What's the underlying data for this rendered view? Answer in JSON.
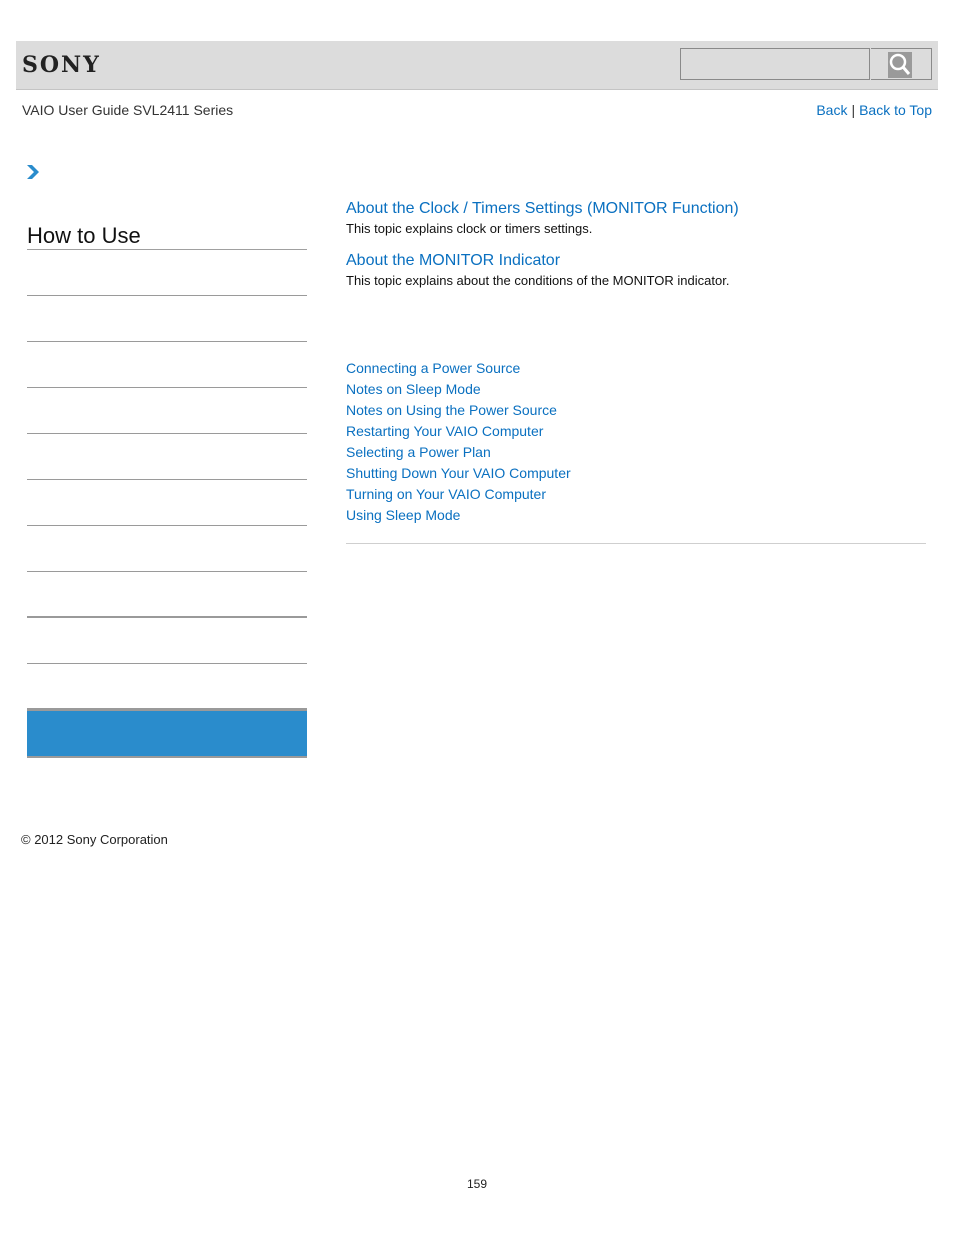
{
  "header": {
    "logo": "SONY",
    "search_placeholder": "",
    "search_icon": "magnifier-icon"
  },
  "guide_title": "VAIO User Guide SVL2411 Series",
  "nav": {
    "back": "Back",
    "separator": "|",
    "back_to_top": "Back to Top"
  },
  "breadcrumb_icon": "chevron-right-icon",
  "sidebar": {
    "title": "How to Use",
    "items": [
      "",
      "",
      "",
      "",
      "",
      "",
      "",
      "",
      "",
      "",
      ""
    ],
    "active_item": ""
  },
  "topics": [
    {
      "title": "About the Clock / Timers Settings (MONITOR Function)",
      "description": "This topic explains clock or timers settings."
    },
    {
      "title": "About the MONITOR Indicator",
      "description": "This topic explains about the conditions of the MONITOR indicator."
    }
  ],
  "related_links": [
    "Connecting a Power Source",
    "Notes on Sleep Mode",
    "Notes on Using the Power Source",
    "Restarting Your VAIO Computer",
    "Selecting a Power Plan",
    "Shutting Down Your VAIO Computer",
    "Turning on Your VAIO Computer",
    "Using Sleep Mode"
  ],
  "footer": {
    "copyright": "© 2012 Sony Corporation",
    "page_number": "159"
  },
  "colors": {
    "link": "#0a70c0",
    "header_bg": "#dcdcdc",
    "active_sidebar": "#2a8ccc"
  }
}
